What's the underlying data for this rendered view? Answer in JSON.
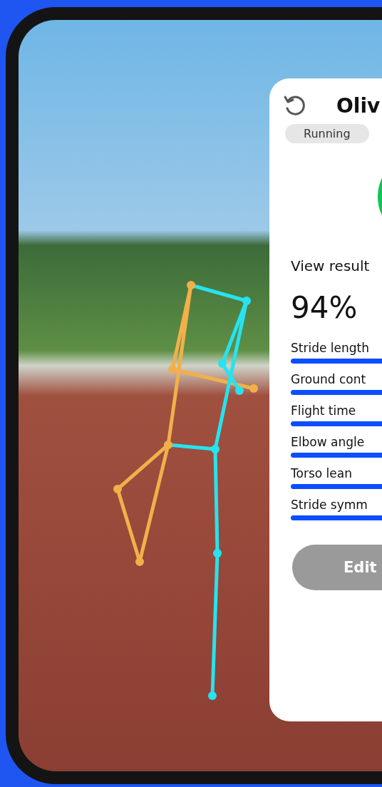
{
  "card": {
    "title": "Oliv",
    "activity_tag": "Running",
    "section_title": "View result",
    "score": "94%",
    "metrics": [
      {
        "label": "Stride length"
      },
      {
        "label": "Ground cont"
      },
      {
        "label": "Flight time"
      },
      {
        "label": "Elbow angle"
      },
      {
        "label": "Torso lean"
      },
      {
        "label": "Stride symm"
      }
    ],
    "button": "Edit"
  }
}
